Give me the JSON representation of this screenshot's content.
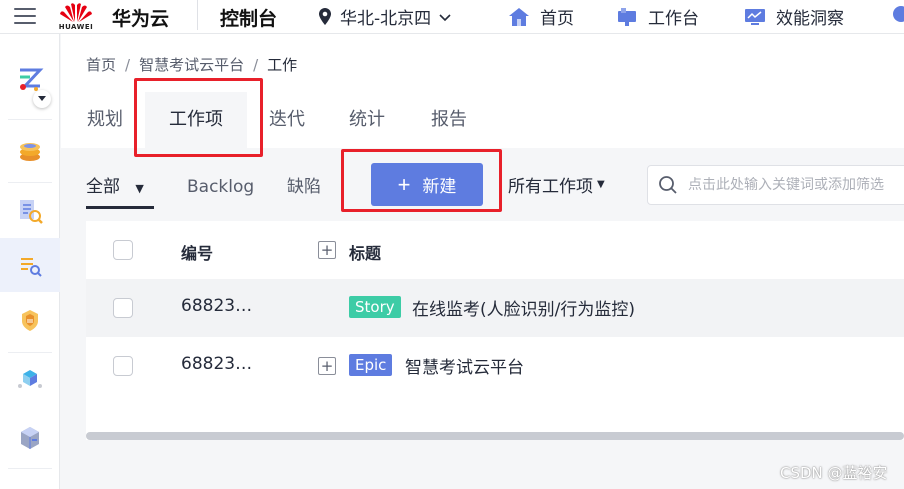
{
  "topbar": {
    "brand": "华为云",
    "logo_text": "HUAWEI",
    "console": "控制台",
    "region": "华北-北京四",
    "nav": [
      {
        "label": "首页",
        "icon": "home-icon"
      },
      {
        "label": "工作台",
        "icon": "workbench-icon"
      },
      {
        "label": "效能洞察",
        "icon": "insight-icon"
      }
    ]
  },
  "sidebar": {
    "items": [
      {
        "icon": "project-logo-icon"
      },
      {
        "icon": "coin-stack-icon"
      },
      {
        "icon": "doc-search-icon"
      },
      {
        "icon": "work-items-icon"
      },
      {
        "icon": "shield-badge-icon"
      },
      {
        "icon": "cube-network-icon"
      },
      {
        "icon": "server-box-icon"
      }
    ]
  },
  "breadcrumb": {
    "items": [
      "首页",
      "智慧考试云平台",
      "工作"
    ],
    "separator": "/"
  },
  "tabs": [
    {
      "label": "规划"
    },
    {
      "label": "工作项"
    },
    {
      "label": "迭代"
    },
    {
      "label": "统计"
    },
    {
      "label": "报告"
    }
  ],
  "filters": {
    "all": "全部",
    "backlog": "Backlog",
    "defect": "缺陷"
  },
  "new_button": {
    "label": "新建"
  },
  "all_items": {
    "label": "所有工作项"
  },
  "search": {
    "placeholder": "点击此处输入关键词或添加筛选"
  },
  "table": {
    "headers": {
      "id": "编号",
      "title": "标题"
    },
    "rows": [
      {
        "id": "68823…",
        "tag": "Story",
        "title": "在线监考(人脸识别/行为监控)"
      },
      {
        "id": "68823…",
        "tag": "Epic",
        "title": "智慧考试云平台"
      }
    ]
  },
  "colors": {
    "primary": "#5e7ce0",
    "story": "#3dcca6",
    "epic": "#5e7ce0",
    "highlight": "#e8202a"
  },
  "watermark": "CSDN @蓝裕安"
}
